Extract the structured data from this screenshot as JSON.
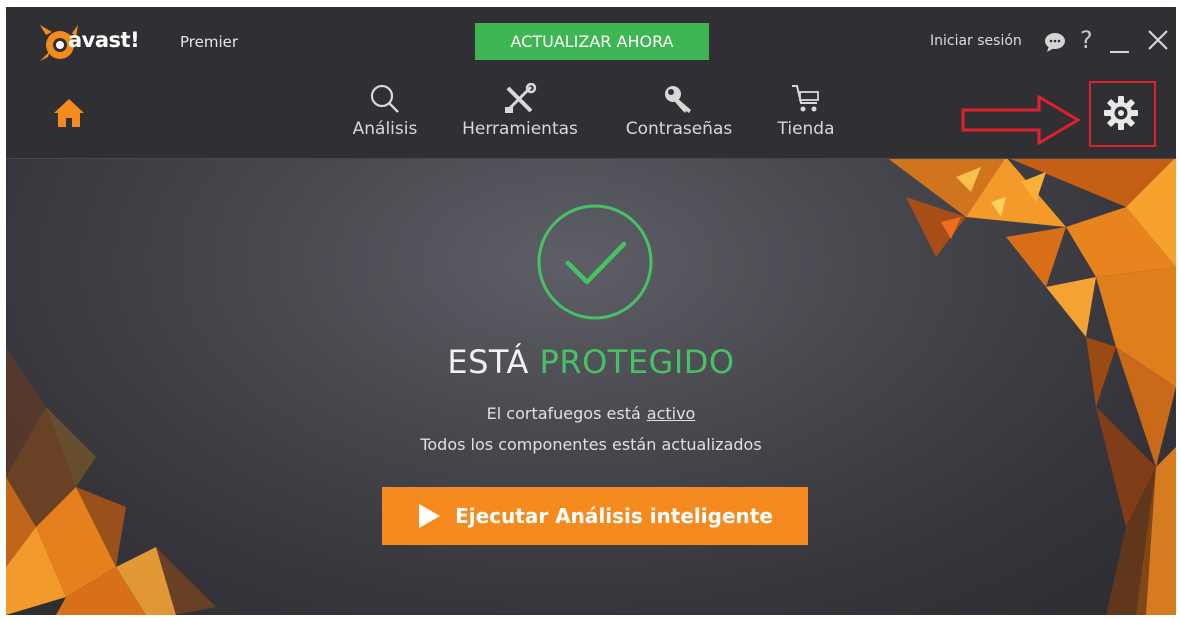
{
  "header": {
    "logo_text": "avast!",
    "edition": "Premier",
    "update_button": "ACTUALIZAR AHORA",
    "signin": "Iniciar sesión",
    "help": "?"
  },
  "nav": {
    "items": [
      {
        "label": "Análisis",
        "icon": "search-icon"
      },
      {
        "label": "Herramientas",
        "icon": "tools-icon"
      },
      {
        "label": "Contraseñas",
        "icon": "key-icon"
      },
      {
        "label": "Tienda",
        "icon": "cart-icon"
      }
    ]
  },
  "status": {
    "prefix": "ESTÁ",
    "highlight": "PROTEGIDO",
    "firewall_text": "El cortafuegos está",
    "firewall_link": "activo",
    "components_text": "Todos los componentes están actualizados"
  },
  "scan_button": "Ejecutar Análisis inteligente",
  "colors": {
    "accent_green": "#47c165",
    "update_green": "#3fb654",
    "orange": "#f58a1f",
    "highlight_red": "#e0202a",
    "background": "#3a3a40"
  }
}
